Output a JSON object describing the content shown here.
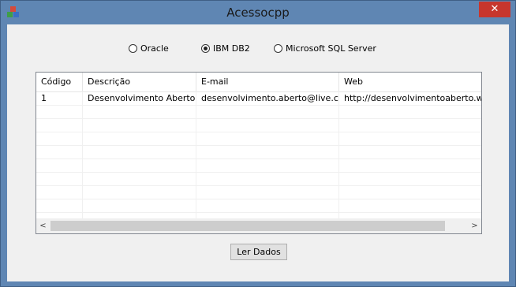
{
  "window": {
    "title": "Acessocpp",
    "close_symbol": "✕"
  },
  "radios": [
    {
      "label": "Oracle",
      "checked": false
    },
    {
      "label": "IBM DB2",
      "checked": true
    },
    {
      "label": "Microsoft SQL Server",
      "checked": false
    }
  ],
  "grid": {
    "columns": [
      "Código",
      "Descrição",
      "E-mail",
      "Web"
    ],
    "rows": [
      [
        "1",
        "Desenvolvimento Aberto",
        "desenvolvimento.aberto@live.com",
        "http://desenvolvimentoaberto.wordpress.com"
      ]
    ],
    "scroll_left_symbol": "<",
    "scroll_right_symbol": ">"
  },
  "button": {
    "label": "Ler Dados"
  },
  "colors": {
    "titlebar": "#5f86b3",
    "close": "#c7362d"
  }
}
